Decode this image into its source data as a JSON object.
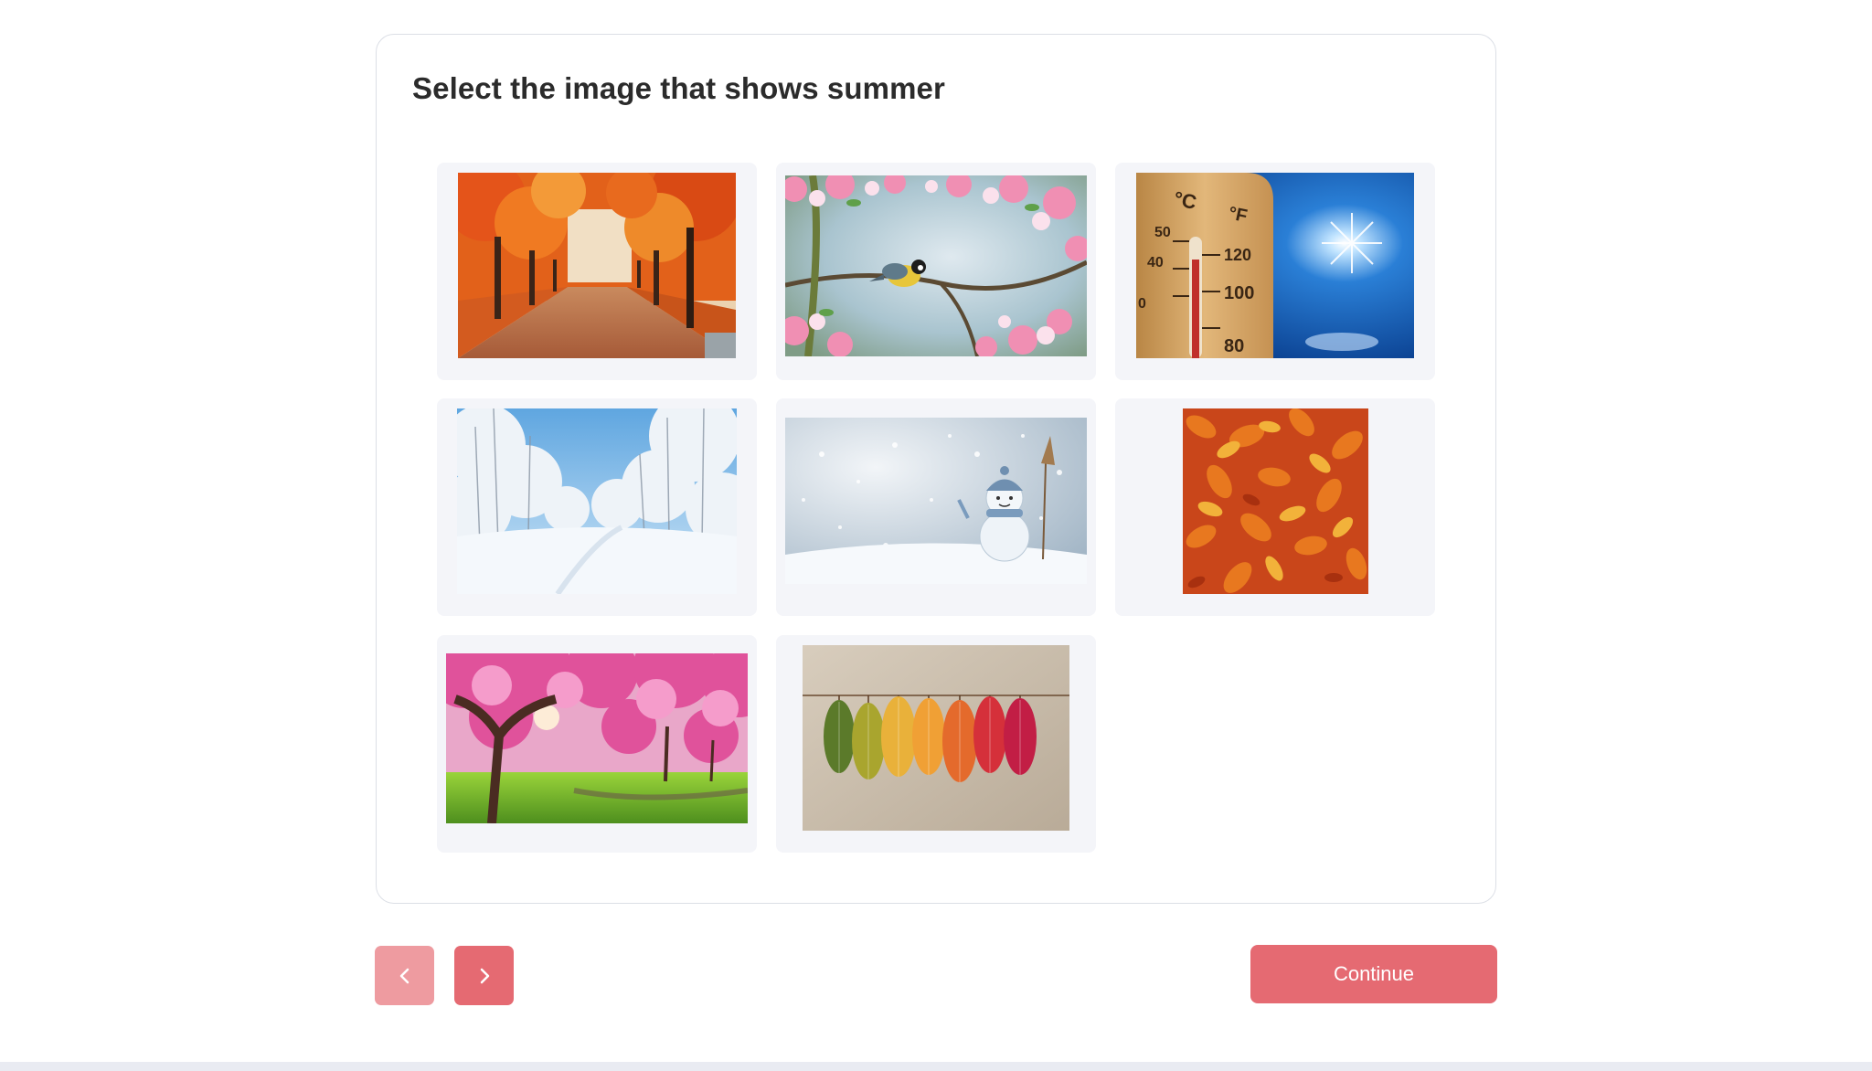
{
  "question": {
    "title": "Select the image that shows summer"
  },
  "options": [
    {
      "scene": "autumn tree-lined avenue",
      "season": "autumn"
    },
    {
      "scene": "bird on blossoming branch",
      "season": "spring"
    },
    {
      "scene": "thermometer against sunny sky",
      "season": "summer",
      "text": {
        "celsius": "°C",
        "fahrenheit": "°F",
        "c_50": "50",
        "c_40": "40",
        "f_120": "120",
        "f_100": "100",
        "f_80": "80",
        "c_0": "0"
      }
    },
    {
      "scene": "snowy forest path",
      "season": "winter"
    },
    {
      "scene": "snowman in snowfall",
      "season": "winter"
    },
    {
      "scene": "fallen orange leaves",
      "season": "autumn"
    },
    {
      "scene": "pink cherry blossom trees",
      "season": "spring"
    },
    {
      "scene": "coloured leaves on a string",
      "season": "autumn"
    }
  ],
  "navigation": {
    "prev_icon": "chevron-left-icon",
    "next_icon": "chevron-right-icon",
    "continue_label": "Continue"
  },
  "colors": {
    "accent": "#e56a72",
    "accent_disabled": "#ee9ba0",
    "tile_background": "#f4f5f9",
    "card_border": "#dcdfe6"
  }
}
